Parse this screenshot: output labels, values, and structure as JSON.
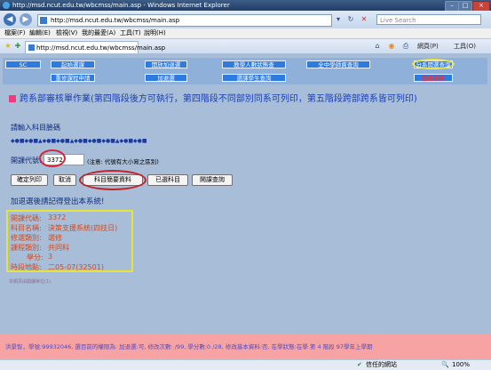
{
  "window": {
    "title": "http://msd.ncut.edu.tw/wbcmss/main.asp - Windows Internet Explorer"
  },
  "address": {
    "url": "http://msd.ncut.edu.tw/wbcmss/main.asp",
    "search_placeholder": "Live Search"
  },
  "menu": [
    "檔案(F)",
    "編輯(E)",
    "檢視(V)",
    "我的最愛(A)",
    "工具(T)",
    "說明(H)"
  ],
  "tab": {
    "label": "http://msd.ncut.edu.tw/wbcmss/main.asp"
  },
  "tools": {
    "page": "網頁(P)",
    "tools": "工具(O)"
  },
  "nav": {
    "row1": [
      "SC",
      "起始選課",
      "開放加退選",
      "教學人數狀態查",
      "全中學師資查詢",
      "分系開選查詢"
    ],
    "row2": [
      "重修課程申請",
      "加退選",
      "選課學生查詢",
      "登出系統"
    ]
  },
  "heading": "跨系部審核單作業(第四階段後方可執行，第四階段不同部別同系可列印，第五階段跨部跨系皆可列印)",
  "prompt": "請輸入科目臉碼",
  "dots": "◆●■◆●■▲◆●■◆●■▲◆●■◆●■◆●■▲◆●■◆●■",
  "code": {
    "label": "開課代號:",
    "value": "3372",
    "note": "(注意: 代號有大小寫之區別)"
  },
  "buttons": [
    "確定列印",
    "取消",
    "科目簡要資料",
    "已選科目",
    "開課查詢"
  ],
  "reminder": "加退選後請記得登出本系統!",
  "info": [
    {
      "label": "開課代碼:",
      "value": "3372"
    },
    {
      "label": "科目名稱:",
      "value": "決策支援系統(四技日)"
    },
    {
      "label": "修選類別:",
      "value": "選修"
    },
    {
      "label": "課程類別:",
      "value": "共同科"
    },
    {
      "label": "學分:",
      "value": "3"
    },
    {
      "label": "時段地點:",
      "value": "二05-07(32501)"
    }
  ],
  "small_note": "本網頁由開課單位(1)",
  "page_status": "洪景智，學號:99932046, 選目前的權限為: 加退選:可, 修改次數: /99, 學分數:0 /28, 修改基本資料:否, 在學狀態:在學 第 4 階段 97學年上學期",
  "statusbar": {
    "zone": "信任的網站",
    "zoom": "100%"
  }
}
